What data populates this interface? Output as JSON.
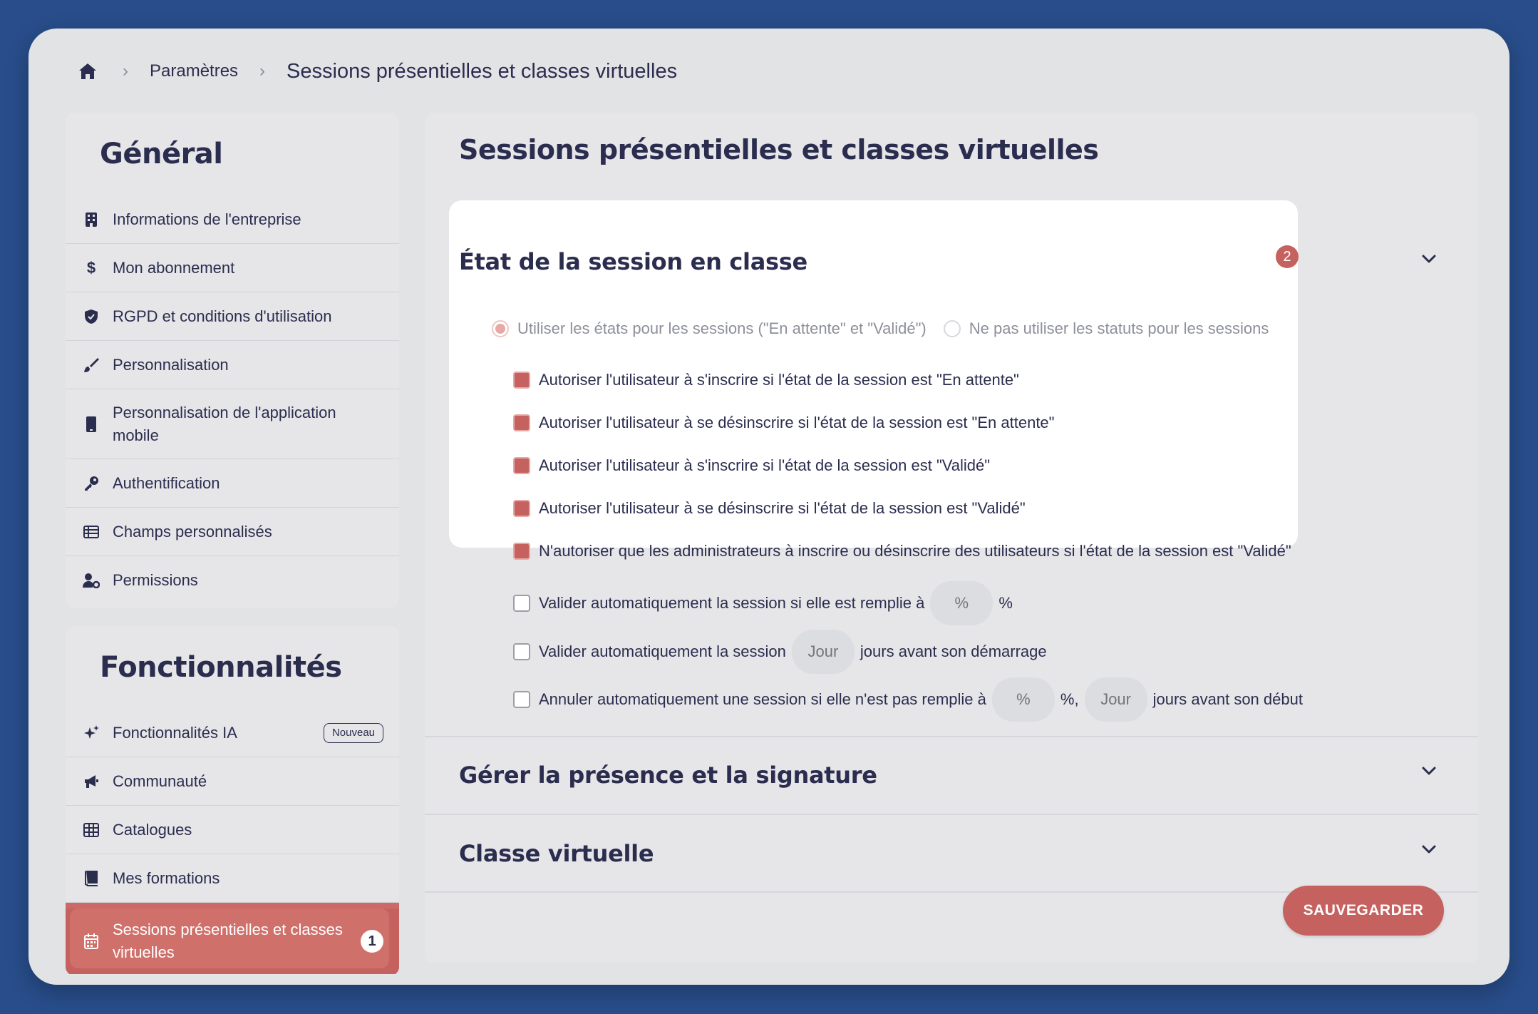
{
  "breadcrumb": {
    "home_icon": "home-icon",
    "items": [
      "Paramètres",
      "Sessions présentielles et classes virtuelles"
    ]
  },
  "sidebar": {
    "general": {
      "title": "Général",
      "items": [
        {
          "label": "Informations de l'entreprise",
          "icon": "building-icon"
        },
        {
          "label": "Mon abonnement",
          "icon": "dollar-icon"
        },
        {
          "label": "RGPD et conditions d'utilisation",
          "icon": "shield-icon"
        },
        {
          "label": "Personnalisation",
          "icon": "brush-icon"
        },
        {
          "label": "Personnalisation de l'application mobile",
          "icon": "mobile-icon"
        },
        {
          "label": "Authentification",
          "icon": "key-icon"
        },
        {
          "label": "Champs personnalisés",
          "icon": "table-list-icon"
        },
        {
          "label": "Permissions",
          "icon": "user-gear-icon"
        }
      ]
    },
    "features": {
      "title": "Fonctionnalités",
      "items": [
        {
          "label": "Fonctionnalités IA",
          "icon": "sparkles-icon",
          "badge": "Nouveau"
        },
        {
          "label": "Communauté",
          "icon": "megaphone-icon"
        },
        {
          "label": "Catalogues",
          "icon": "grid-icon"
        },
        {
          "label": "Mes formations",
          "icon": "book-icon"
        },
        {
          "label": "Sessions présentielles et classes virtuelles",
          "icon": "calendar-icon",
          "active": true,
          "step": "1"
        }
      ]
    }
  },
  "main": {
    "title": "Sessions présentielles et classes virtuelles",
    "sections": [
      {
        "title": "État de la session en classe",
        "step": "2",
        "expanded": true
      },
      {
        "title": "Gérer la présence et la signature",
        "expanded": false
      },
      {
        "title": "Classe virtuelle",
        "expanded": false
      }
    ],
    "radios": [
      {
        "label": "Utiliser les états pour les sessions (\"En attente\" et \"Validé\")",
        "selected": true
      },
      {
        "label": "Ne pas utiliser les statuts pour les sessions",
        "selected": false
      }
    ],
    "checks": [
      {
        "label": "Autoriser l'utilisateur à s'inscrire si l'état de la session est \"En attente\"",
        "checked": true
      },
      {
        "label": "Autoriser l'utilisateur à se désinscrire si l'état de la session est \"En attente\"",
        "checked": true
      },
      {
        "label": "Autoriser l'utilisateur à s'inscrire si l'état de la session est \"Validé\"",
        "checked": true
      },
      {
        "label": "Autoriser l'utilisateur à se désinscrire si l'état de la session est \"Validé\"",
        "checked": true
      },
      {
        "label": "N'autoriser que les administrateurs à inscrire ou désinscrire des utilisateurs si l'état de la session est \"Validé\"",
        "checked": true
      }
    ],
    "auto_validate_fill": {
      "before": "Valider automatiquement la session si elle est remplie à",
      "placeholder": "%",
      "after": "%",
      "checked": false
    },
    "auto_validate_days": {
      "before": "Valider automatiquement la session",
      "placeholder": "Jour",
      "after": "jours avant son démarrage",
      "checked": false
    },
    "auto_cancel": {
      "before": "Annuler automatiquement une session si elle n'est pas remplie à",
      "placeholder_pct": "%",
      "middle": "%,",
      "placeholder_days": "Jour",
      "after": "jours avant son début",
      "checked": false
    },
    "save_label": "SAUVEGARDER"
  },
  "colors": {
    "background": "#284d8a",
    "accent": "#c5625f",
    "text": "#2b2d4f"
  }
}
